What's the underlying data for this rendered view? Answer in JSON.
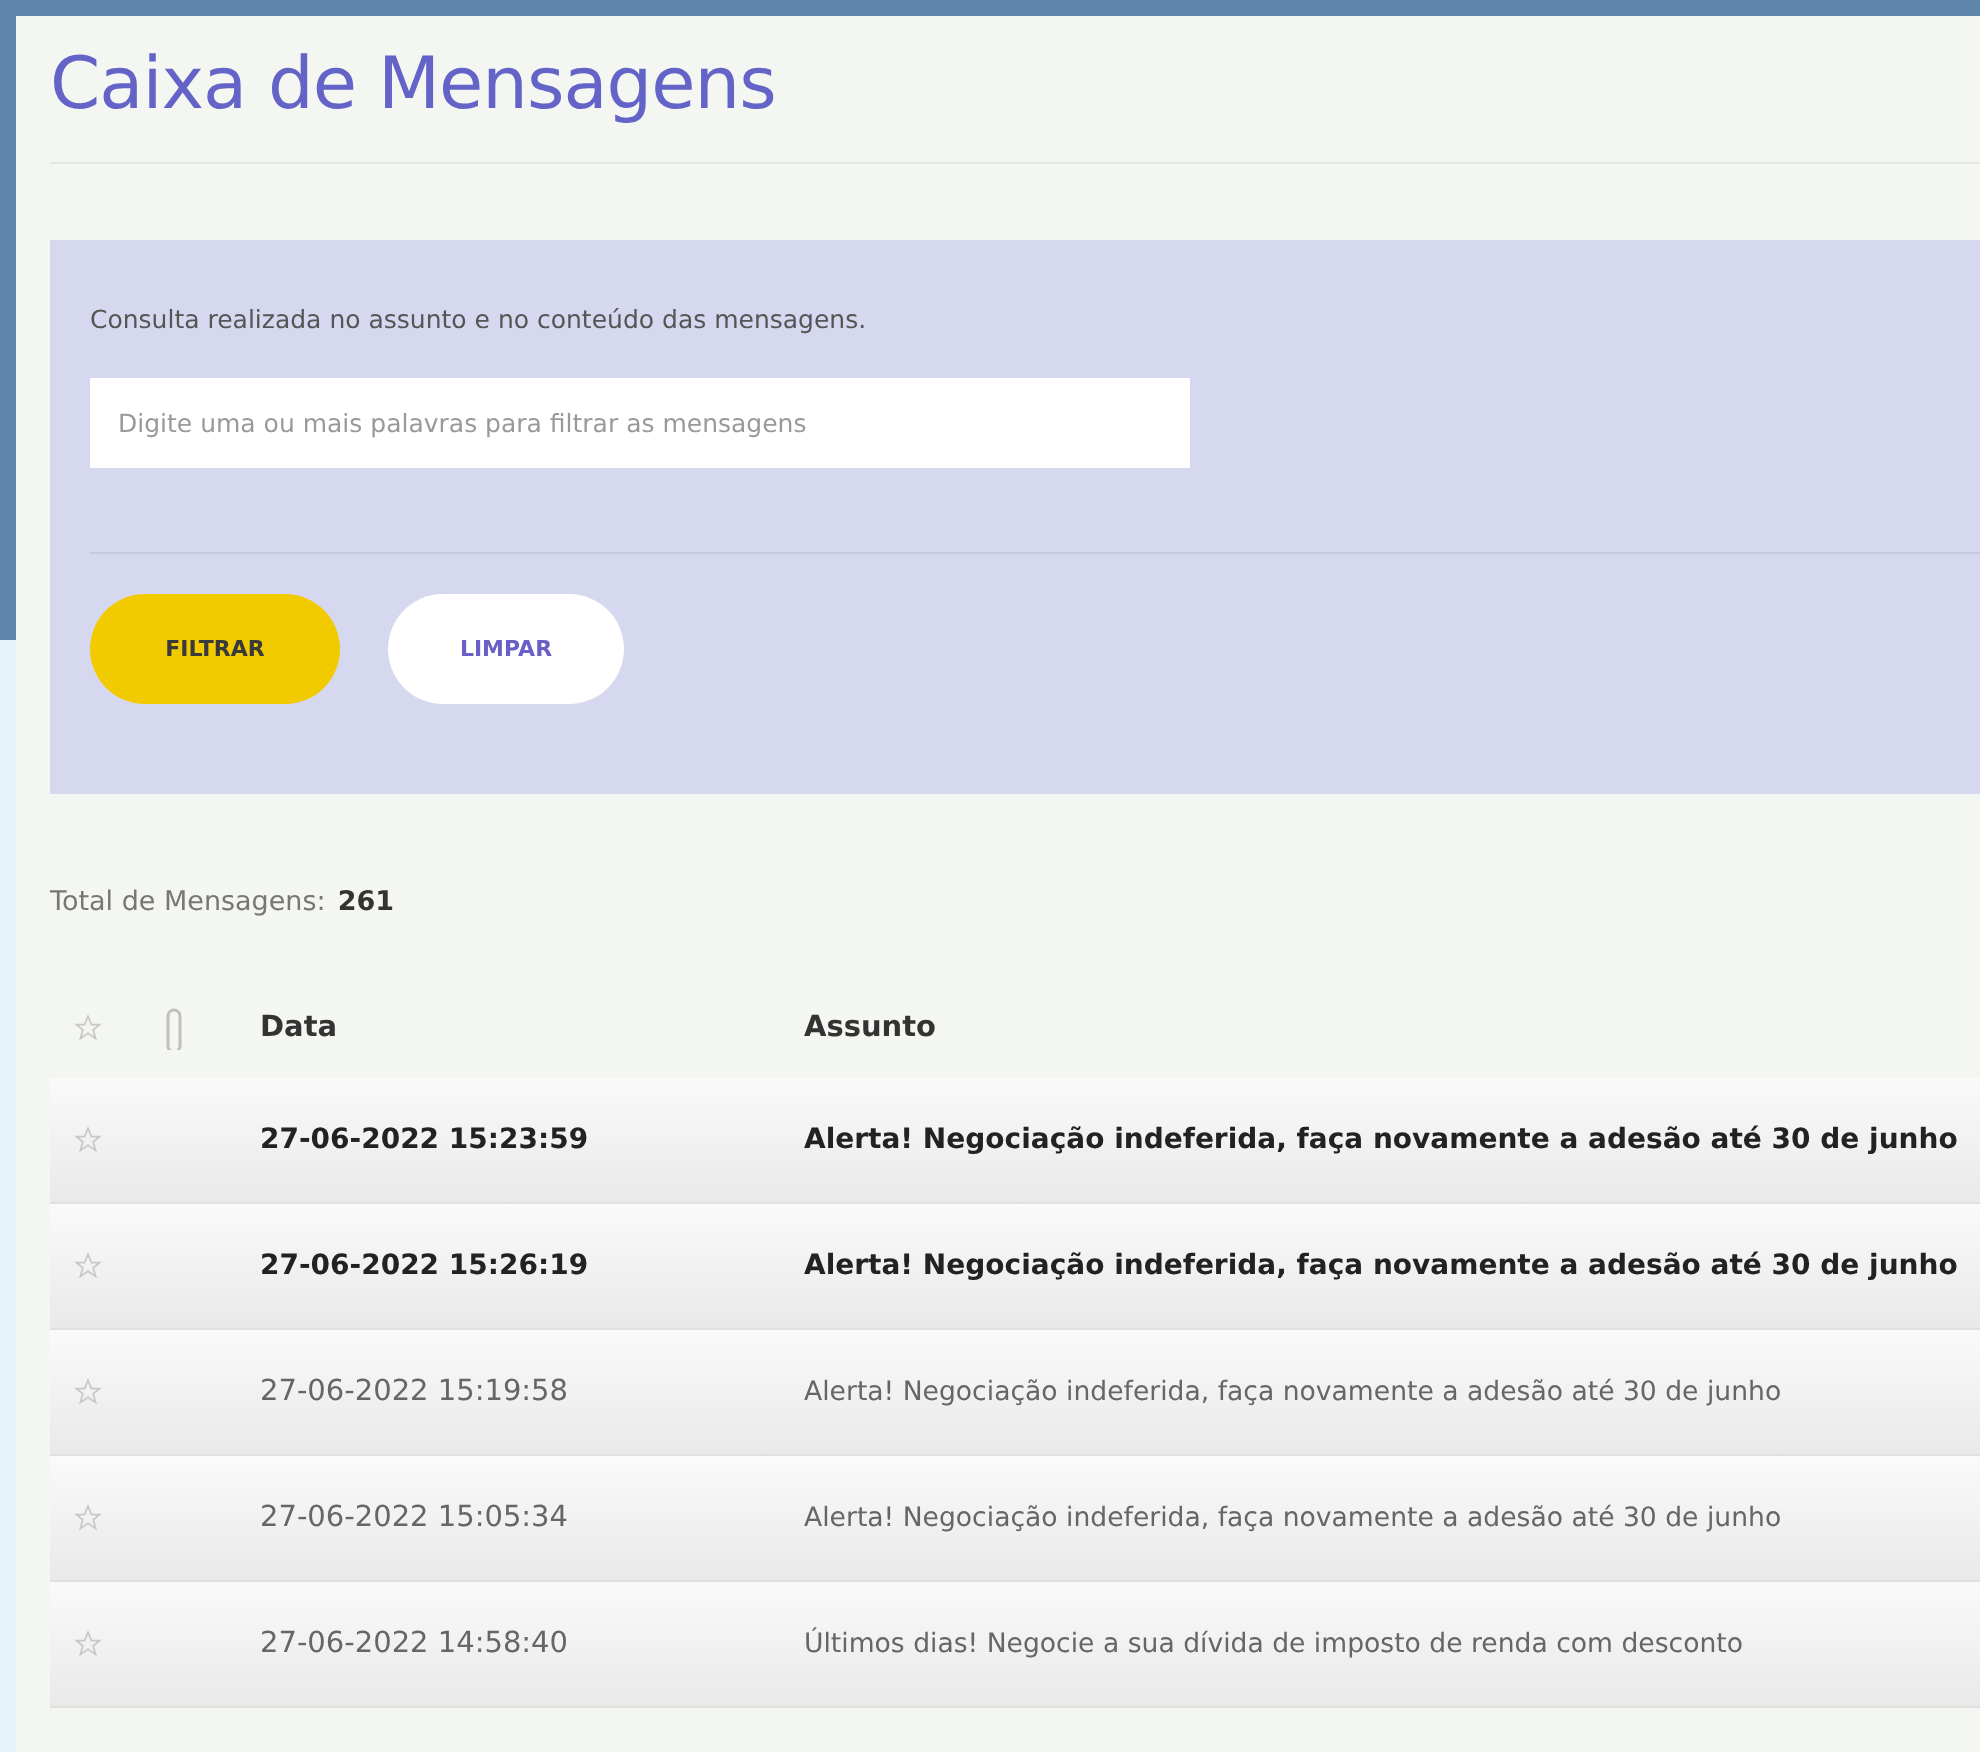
{
  "page_title": "Caixa de Mensagens",
  "filter": {
    "hint": "Consulta realizada no assunto e no conteúdo das mensagens.",
    "search": {
      "placeholder": "Digite uma ou mais palavras para filtrar as mensagens"
    },
    "buttons": [
      {
        "label": "FILTRAR",
        "kind": "primary"
      },
      {
        "label": "LIMPAR",
        "kind": "secondary"
      }
    ]
  },
  "total": {
    "label": "Total de Mensagens:",
    "count": "261"
  },
  "table": {
    "columns": [
      "Data",
      "Assunto"
    ],
    "rows": [
      {
        "starred": false,
        "unread": true,
        "date": "27-06-2022 15:23:59",
        "subject": "Alerta! Negociação indeferida, faça novamente a adesão até 30 de junho"
      },
      {
        "starred": false,
        "unread": true,
        "date": "27-06-2022 15:26:19",
        "subject": "Alerta! Negociação indeferida, faça novamente a adesão até 30 de junho"
      },
      {
        "starred": false,
        "unread": false,
        "date": "27-06-2022 15:19:58",
        "subject": "Alerta! Negociação indeferida, faça novamente a adesão até 30 de junho"
      },
      {
        "starred": false,
        "unread": false,
        "date": "27-06-2022 15:05:34",
        "subject": "Alerta! Negociação indeferida, faça novamente a adesão até 30 de junho"
      },
      {
        "starred": false,
        "unread": false,
        "date": "27-06-2022 14:58:40",
        "subject": "Últimos dias! Negocie a sua dívida de imposto de renda com desconto"
      }
    ]
  }
}
